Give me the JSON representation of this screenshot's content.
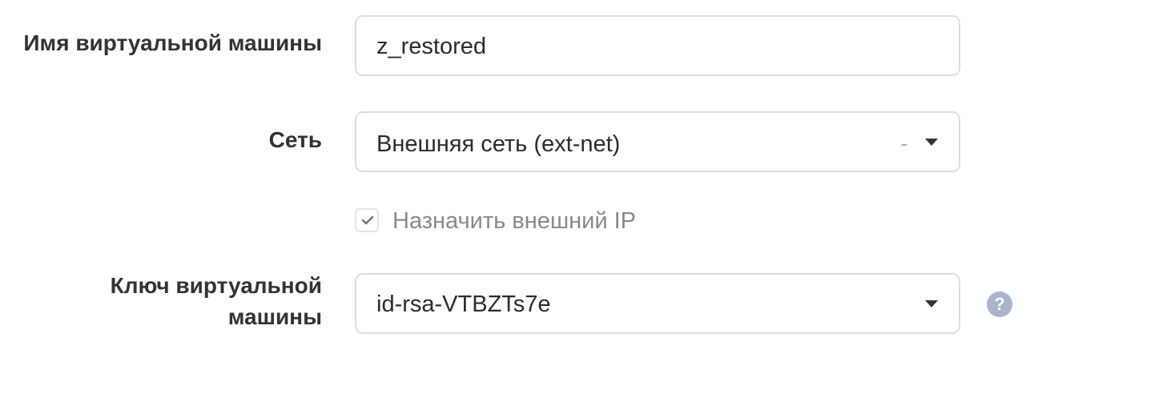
{
  "form": {
    "vm_name": {
      "label": "Имя виртуальной машины",
      "value": "z_restored"
    },
    "network": {
      "label": "Сеть",
      "selected": "Внешняя сеть (ext-net)",
      "clear_symbol": "-"
    },
    "assign_external_ip": {
      "label": "Назначить внешний IP",
      "checked": true
    },
    "vm_key": {
      "label_line1": "Ключ виртуальной",
      "label_line2": "машины",
      "selected": "id-rsa-VTBZTs7e"
    },
    "help": {
      "symbol": "?"
    }
  },
  "colors": {
    "border": "#dcdde3",
    "label_text": "#333333",
    "muted_text": "#8a8a8a",
    "help_icon": "#a9b3cc"
  },
  "icons": {
    "dropdown": "chevron-down-icon",
    "check": "checkmark-icon",
    "help": "question-mark-icon"
  }
}
